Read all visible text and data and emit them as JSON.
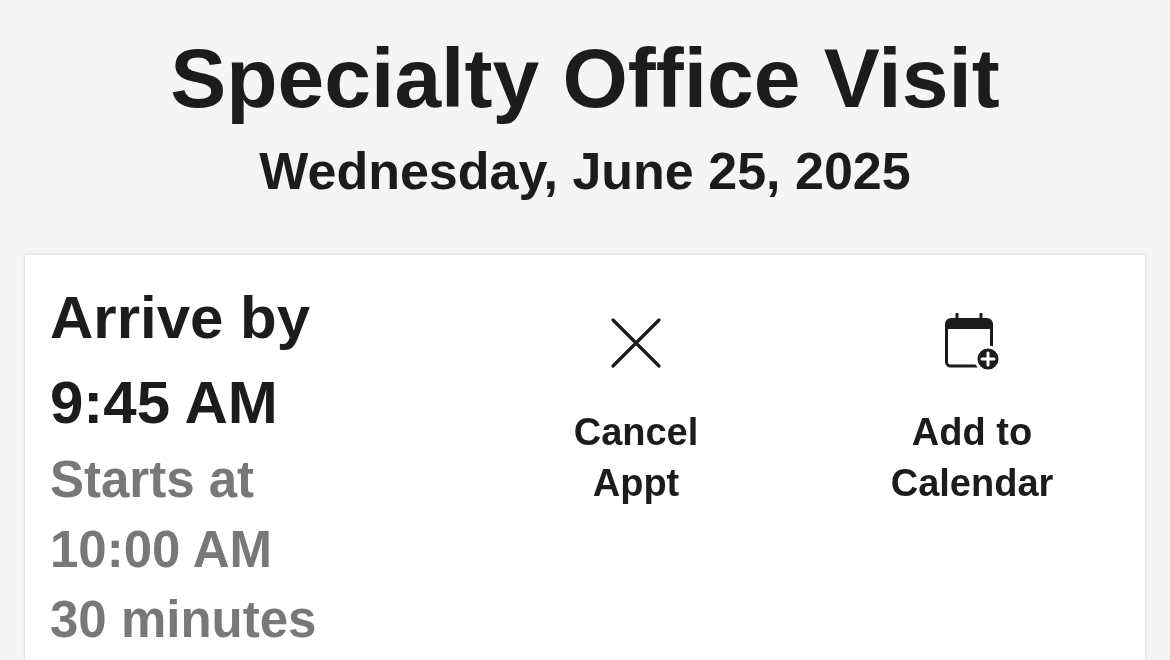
{
  "title": "Specialty Office Visit",
  "date": "Wednesday, June 25, 2025",
  "appointment": {
    "arrive_by": "Arrive by 9:45 AM",
    "starts_at": "Starts at 10:00 AM",
    "duration": "30 minutes"
  },
  "actions": [
    {
      "kind": "cancel",
      "label": "Cancel Appt"
    },
    {
      "kind": "add_to_calendar",
      "label": "Add to Calendar"
    }
  ]
}
